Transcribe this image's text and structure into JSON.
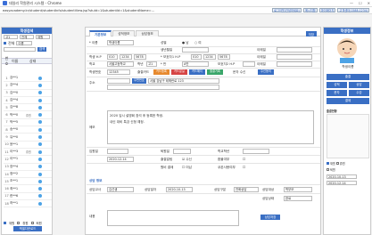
{
  "window": {
    "title": "데일리 학원관리 시스템 - Chrome",
    "url": "easyacademy.kr/student/studentInfo/studentView.jsp?stuId=1&studentId=1&studentName=..."
  },
  "topbar": {
    "buttons": [
      "로그아웃(안녕하세요)",
      "메시지함",
      "마이페이지",
      "고객센터(1588-1234)"
    ]
  },
  "left": {
    "title": "학생검색",
    "filters": {
      "grade": "고1",
      "class": "전체",
      "status": "재원",
      "sort": "이름",
      "all_label": "전체"
    },
    "search_label": "검색",
    "list_header": {
      "no": "번호",
      "name": "이름",
      "status": "상태"
    },
    "students": [
      {
        "no": "1",
        "name": "강**1",
        "status": ""
      },
      {
        "no": "2",
        "name": "강**4",
        "status": ""
      },
      {
        "no": "3",
        "name": "김**0",
        "status": ""
      },
      {
        "no": "4",
        "name": "김**4",
        "status": ""
      },
      {
        "no": "5",
        "name": "김**8",
        "status": ""
      },
      {
        "no": "6",
        "name": "박**0",
        "status": "휴원"
      },
      {
        "no": "7",
        "name": "박**5",
        "status": ""
      },
      {
        "no": "8",
        "name": "송**0",
        "status": ""
      },
      {
        "no": "9",
        "name": "유**0",
        "status": ""
      },
      {
        "no": "10",
        "name": "윤**1",
        "status": ""
      },
      {
        "no": "11",
        "name": "이**3",
        "status": "휴원"
      },
      {
        "no": "12",
        "name": "이**1",
        "status": ""
      },
      {
        "no": "13",
        "name": "장**4",
        "status": ""
      },
      {
        "no": "14",
        "name": "정**2",
        "status": ""
      },
      {
        "no": "15",
        "name": "조**1",
        "status": ""
      },
      {
        "no": "16",
        "name": "최**1",
        "status": ""
      },
      {
        "no": "17",
        "name": "한**6",
        "status": ""
      },
      {
        "no": "18",
        "name": "허**1",
        "status": ""
      }
    ],
    "footer": {
      "opt1": "재원",
      "opt2": "휴원",
      "opt3": "퇴원",
      "button": "엑셀다운로드"
    }
  },
  "main": {
    "tabs": [
      "기본정보",
      "성적정보",
      "상담정보"
    ],
    "edit_button": "저장",
    "fields": {
      "name_label": "* 이름",
      "name_value": "학생이름",
      "gender_label": "성별",
      "gender_m": "남",
      "gender_f": "여",
      "birth_label": "생년월일",
      "phone_label": "학생 H.P",
      "phone_values": [
        "010",
        "1234",
        "5678"
      ],
      "parent_phone_label": "* 보호자1 H.P",
      "parent_phone_values": [
        "010",
        "1234",
        "5678"
      ],
      "email_label": "이메일",
      "school_label": "학교",
      "school_value": "서울고등학교",
      "grade_label": "학년",
      "grade_value": "고1",
      "class_label": "* 반",
      "class_value": "A반",
      "parent2_label": "보호자2 H.P",
      "student_no_label": "학생번호",
      "student_no_value": "12345",
      "card_label": "출결카드",
      "card_buttons": [
        "카드등록",
        "카드분실",
        "카드해지",
        "출결기록"
      ],
      "sms_label": "문자 수신",
      "sms_value": "수신동의",
      "address_label": "주소",
      "zip_button": "우편번호",
      "address_value": "서울 강남구 테헤란로 123",
      "memo_label": "메모",
      "memo_lines": [
        "2020 입시 설명회 참석 후 등록한 학생.",
        "내신 대비 특강 신청 예정."
      ],
      "enroll_label": "입원일",
      "enroll_value": "2020-12-14",
      "leave_label": "퇴원일",
      "school_year_label": "학교학년",
      "attend_label": "출결알림",
      "attend_value": "수신",
      "refund_label": "환불여부",
      "fee_label": "원비 결제",
      "fee_value": "미납",
      "coupon_label": "쿠폰사용여부",
      "consult_section": "상담 정보",
      "consult_teacher_label": "상담교사",
      "consult_teacher_value": "김선생",
      "consult_date_label": "상담일자",
      "consult_date_value": "2020-10-13",
      "consult_type_label": "상담구분",
      "consult_type_value": "전화상담",
      "consult_target_label": "상담대상",
      "consult_target_value": "학부모",
      "consult_status_label": "상담상태",
      "consult_status_value": "완료",
      "consult_memo_label": "내용",
      "save_consult": "상담저장"
    }
  },
  "right": {
    "title": "학생정보",
    "name": "학생이름",
    "buttons": [
      "출결",
      "성적",
      "상담",
      "문자",
      "수강",
      "결제"
    ],
    "attend_title": "출결현황",
    "attend_check": [
      "재원",
      "휴원",
      "퇴원"
    ],
    "date_from": "2020-10-13",
    "date_to": "2020-12-14"
  }
}
